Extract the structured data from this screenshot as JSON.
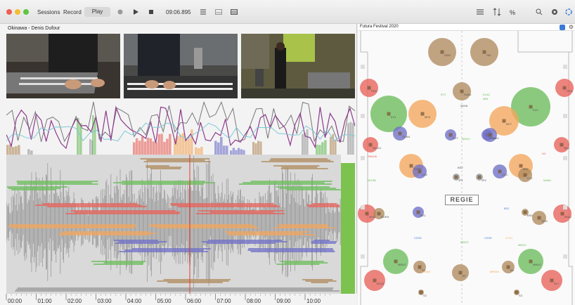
{
  "toolbar": {
    "sessions_label": "Sessions",
    "record_label": "Record",
    "play_label": "Play",
    "timecode": "09:06.895",
    "percent_label": "%"
  },
  "session": {
    "title": "Okinawa - Denis Dufour"
  },
  "timeline": {
    "ticks": [
      "00:00",
      "01:00",
      "02:00",
      "03:00",
      "04:00",
      "05:00",
      "06:00",
      "07:00",
      "08:00",
      "09:00",
      "10:00"
    ],
    "playhead": "06:00"
  },
  "map": {
    "festival": "Futura Festival 2020",
    "regie": "REGIE",
    "labels": {
      "sem": "SEM",
      "sel": "SEL",
      "fen": "FEN",
      "et2": "ET2",
      "ev1": "EV1",
      "et1": "ET1",
      "mf8": "MF8",
      "mf7": "MF7",
      "sub1": "SUB1",
      "elac": "ELAC",
      "mbi": "MBI",
      "rmb": "RMB",
      "ev2": "EV2",
      "m408": "M408",
      "m409": "M409",
      "m410": "M410",
      "c408": "C408",
      "c409": "C409",
      "c410": "C410",
      "rm408": "RM408",
      "cum4": "CUM4",
      "cfc": "CFC",
      "mk1": "MK1",
      "dy1": "DY1",
      "tupp": "TUPP",
      "cuc": "CUC",
      "ch2": "CH2",
      "bv1": "BV1",
      "nk412": "NK412",
      "jp1": "JP1",
      "jp2": "JP2",
      "bs2": "BS2",
      "cet": "CET",
      "m6b": "M6B",
      "m4ba": "M4BA",
      "mr004": "MR004",
      "m4ba2": "M4BA",
      "mr004b": "MR004",
      "b2c": "B2C",
      "bs5": "BS5",
      "cycl": "CYCL",
      "bs6": "BS6",
      "m411": "M411",
      "gen": "GEN",
      "bgen": "BGEN",
      "m412": "M412",
      "cs2": "C2SD",
      "cs3": "C2SD",
      "mbgc1": "MBGC",
      "mbgc2": "MBGC",
      "mbgc3": "MBGC",
      "b3": "B3",
      "b4": "B4",
      "mgsb": "MGSB",
      "bool": "BOOL",
      "dly": "DLY",
      "cuc2": "CUC",
      "bt": "BT",
      "nc": "NC",
      "s2": "S2",
      "s3": "S3",
      "s4": "S4"
    }
  },
  "colors": {
    "red": "#e8625a",
    "green": "#6bbd5b",
    "orange": "#f3a65c",
    "blue": "#6f6fc8",
    "brown": "#b08a5e",
    "grey": "#999999",
    "purple": "#8d3a8c",
    "cyan": "#7fc9d6"
  }
}
